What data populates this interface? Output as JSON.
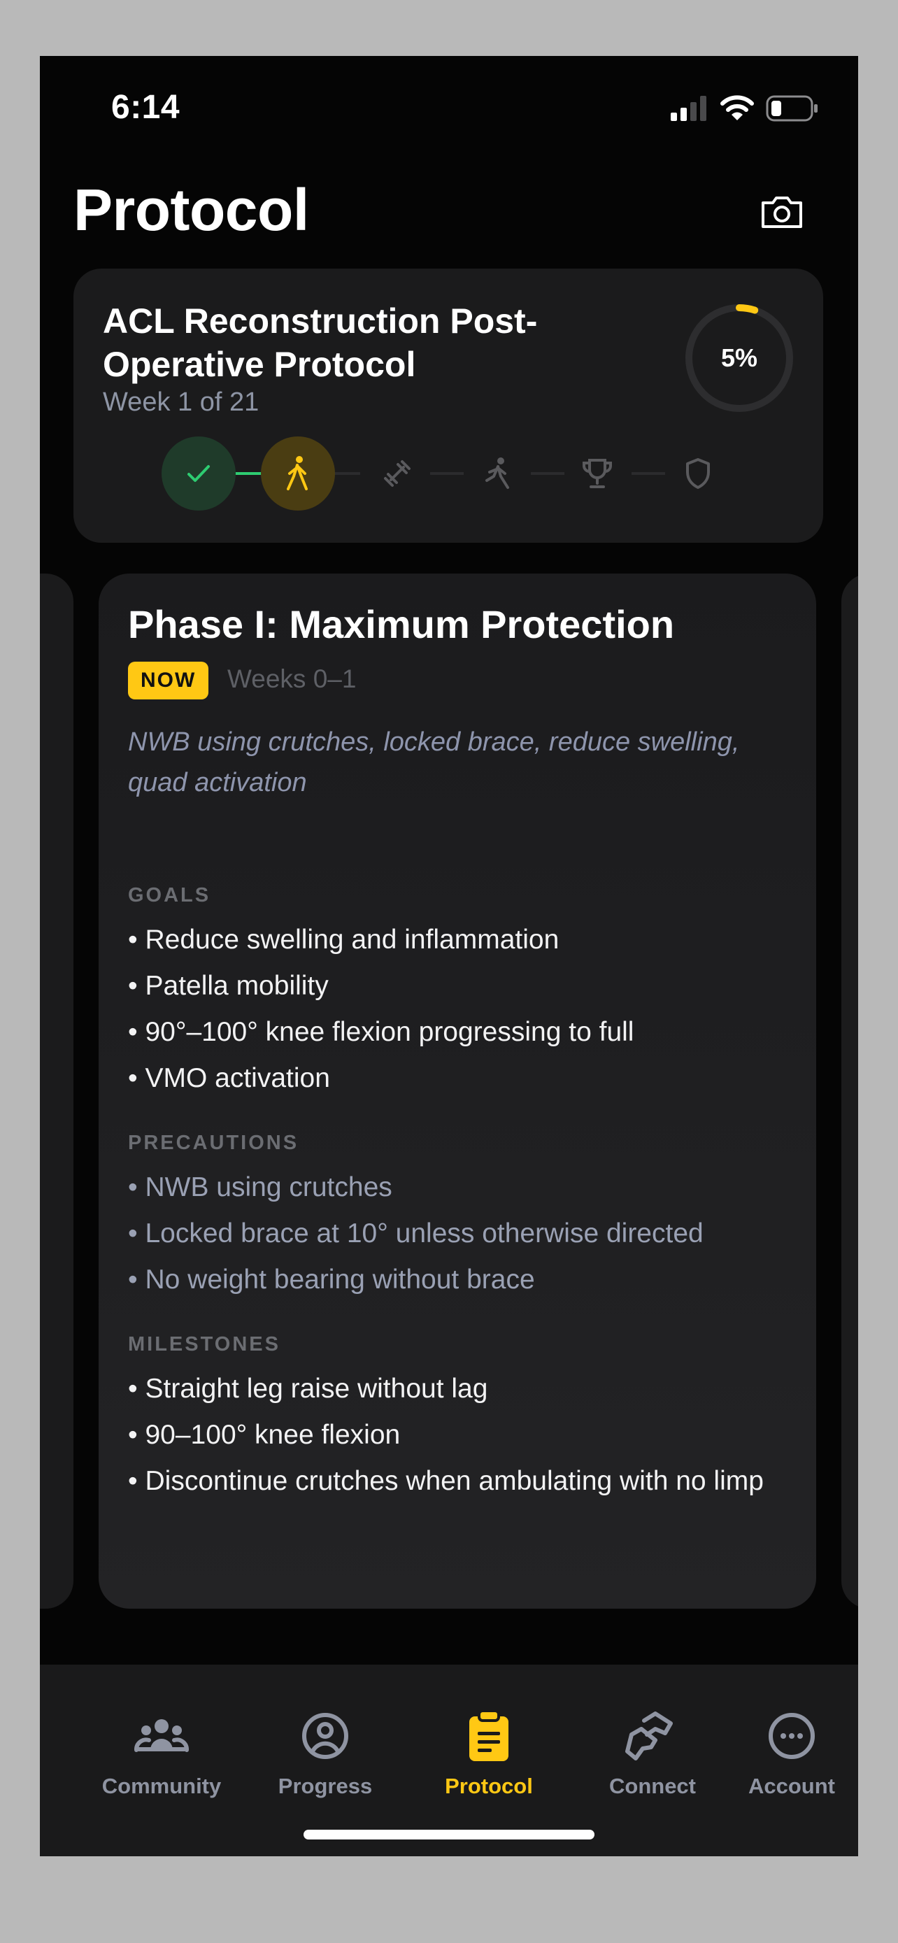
{
  "status_bar": {
    "time": "6:14"
  },
  "header": {
    "title": "Protocol"
  },
  "protocol": {
    "title": "ACL Reconstruction Post-Operative Protocol",
    "week": "Week 1 of 21",
    "progress_label": "5%",
    "progress_fraction": 0.05,
    "steps": [
      {
        "icon": "check-icon",
        "state": "done"
      },
      {
        "icon": "walking-icon",
        "state": "current"
      },
      {
        "icon": "dumbbell-icon",
        "state": "upcoming"
      },
      {
        "icon": "running-icon",
        "state": "upcoming"
      },
      {
        "icon": "trophy-icon",
        "state": "upcoming"
      },
      {
        "icon": "shield-icon",
        "state": "upcoming"
      }
    ]
  },
  "phase": {
    "title": "Phase I: Maximum Protection",
    "badge": "NOW",
    "weeks": "Weeks 0–1",
    "summary": "NWB using crutches, locked brace, reduce swelling, quad activation",
    "goals_label": "GOALS",
    "goals": [
      "• Reduce swelling and inflammation",
      "• Patella mobility",
      "• 90°–100° knee flexion progressing to full",
      "• VMO activation"
    ],
    "precautions_label": "PRECAUTIONS",
    "precautions": [
      "• NWB using crutches",
      "• Locked brace at 10° unless otherwise directed",
      "• No weight bearing without brace"
    ],
    "milestones_label": "MILESTONES",
    "milestones": [
      "• Straight leg raise without lag",
      "• 90–100° knee flexion",
      "• Discontinue crutches when ambulating with no limp"
    ]
  },
  "tabs": [
    {
      "label": "Community",
      "icon": "community-icon",
      "active": false
    },
    {
      "label": "Progress",
      "icon": "progress-icon",
      "active": false
    },
    {
      "label": "Protocol",
      "icon": "clipboard-icon",
      "active": true
    },
    {
      "label": "Connect",
      "icon": "connect-icon",
      "active": false
    },
    {
      "label": "Account",
      "icon": "account-icon",
      "active": false
    }
  ],
  "colors": {
    "accent": "#ffc814",
    "success": "#2ecc71",
    "muted": "#8e95a5"
  }
}
